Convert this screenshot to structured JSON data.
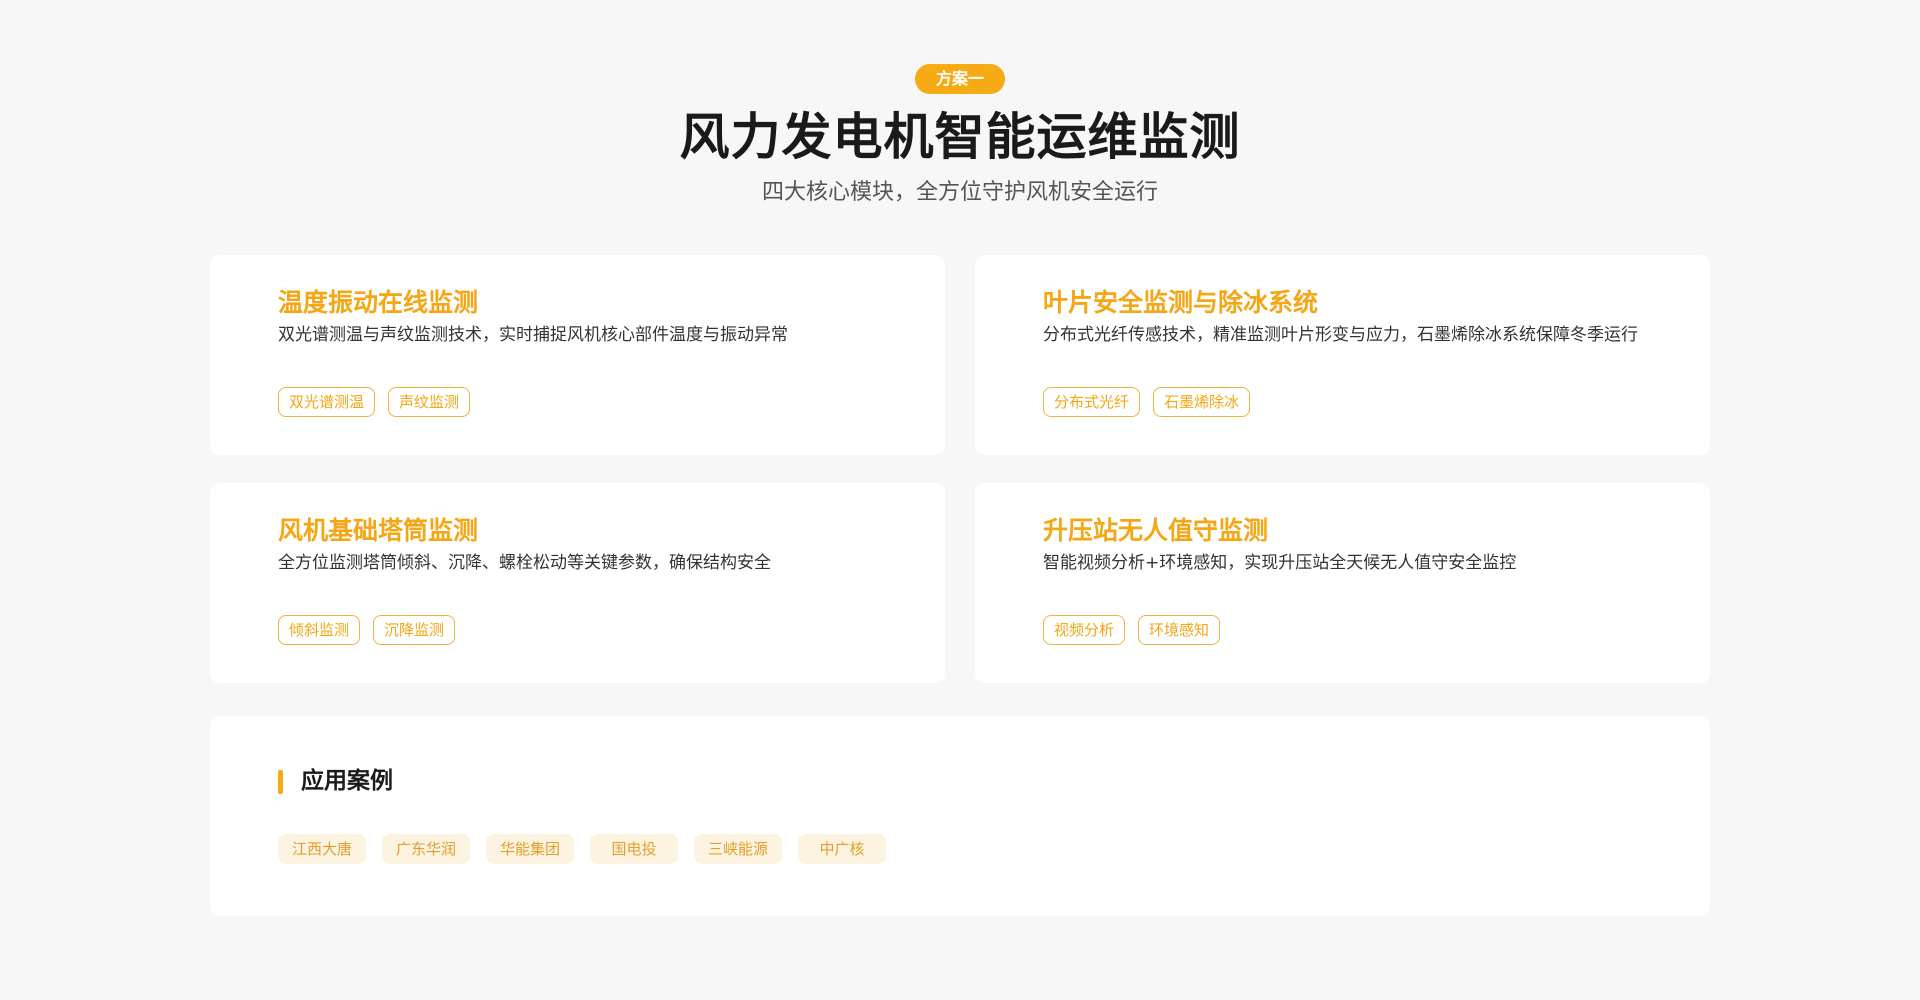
{
  "header": {
    "badge": "方案一",
    "title": "风力发电机智能运维监测",
    "subtitle": "四大核心模块，全方位守护风机安全运行"
  },
  "modules": [
    {
      "title": "温度振动在线监测",
      "desc": "双光谱测温与声纹监测技术，实时捕捉风机核心部件温度与振动异常",
      "tags": [
        "双光谱测温",
        "声纹监测"
      ]
    },
    {
      "title": "叶片安全监测与除冰系统",
      "desc": "分布式光纤传感技术，精准监测叶片形变与应力，石墨烯除冰系统保障冬季运行",
      "tags": [
        "分布式光纤",
        "石墨烯除冰"
      ]
    },
    {
      "title": "风机基础塔筒监测",
      "desc": "全方位监测塔筒倾斜、沉降、螺栓松动等关键参数，确保结构安全",
      "tags": [
        "倾斜监测",
        "沉降监测"
      ]
    },
    {
      "title": "升压站无人值守监测",
      "desc": "智能视频分析+环境感知，实现升压站全天候无人值守安全监控",
      "tags": [
        "视频分析",
        "环境感知"
      ]
    }
  ],
  "cases": {
    "title": "应用案例",
    "items": [
      "江西大唐",
      "广东华润",
      "华能集团",
      "国电投",
      "三峡能源",
      "中广核"
    ]
  },
  "colors": {
    "accent": "#f6aa14",
    "background": "#f7f7f7",
    "card": "#ffffff"
  }
}
